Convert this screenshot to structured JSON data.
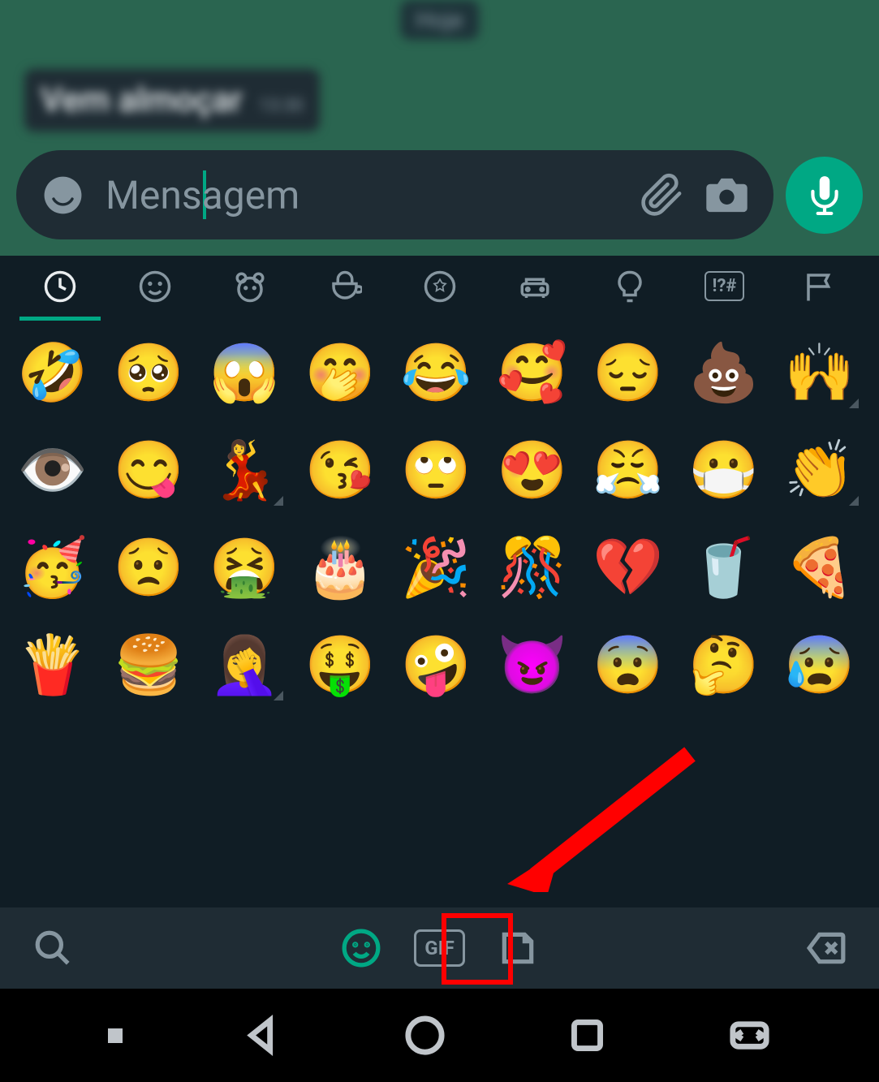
{
  "chat": {
    "date_label": "Hoje",
    "message_text": "Vem almoçar",
    "message_time": "13:30"
  },
  "input": {
    "placeholder": "Mensagem"
  },
  "categories": {
    "recent": "recent",
    "smileys": "smileys",
    "animals": "animals",
    "food": "food",
    "activity": "activity",
    "travel": "travel",
    "objects": "objects",
    "symbols": "!?#",
    "flags": "flags"
  },
  "emojis": {
    "row1": [
      "🤣",
      "🥺",
      "😱",
      "🤭",
      "😂",
      "🥰",
      "😔",
      "💩",
      "🙌"
    ],
    "row2": [
      "👁️",
      "😋",
      "💃",
      "😘",
      "🙄",
      "😍",
      "😤",
      "😷",
      "👏"
    ],
    "row3": [
      "🥳",
      "😟",
      "🤮",
      "🎂",
      "🎉",
      "🎊",
      "💔",
      "🥤",
      "🍕"
    ],
    "row4": [
      "🍟",
      "🍔",
      "🤦‍♀️",
      "🤑",
      "🤪",
      "😈",
      "😨",
      "🤔",
      "😰"
    ]
  },
  "bottom_bar": {
    "gif_label": "GIF"
  },
  "colors": {
    "accent": "#00a884",
    "bg_dark": "#101d25",
    "bg_input": "#1f2c34",
    "highlight": "#ff0000"
  }
}
